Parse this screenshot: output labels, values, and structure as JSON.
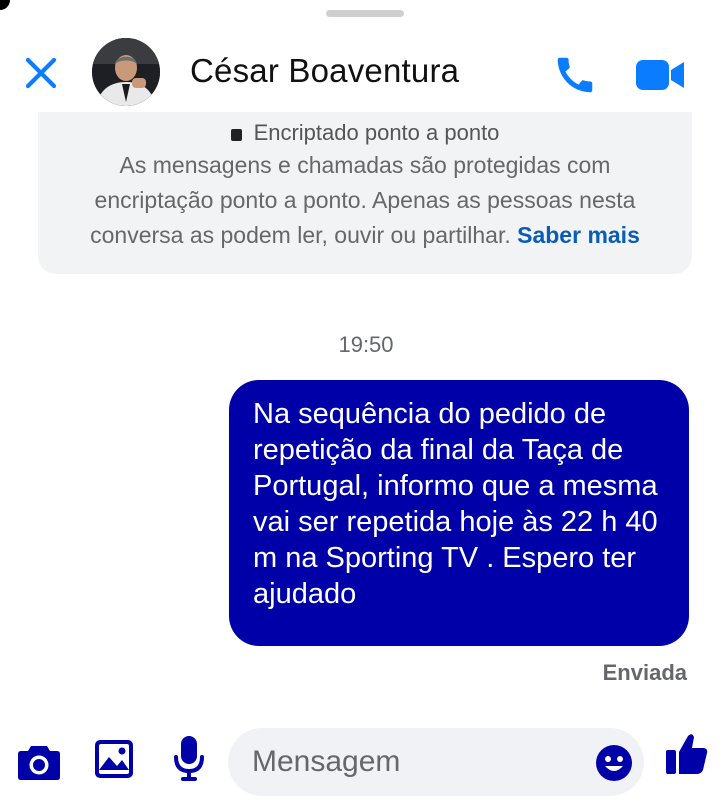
{
  "header": {
    "contact_name": "César Boaventura"
  },
  "encryption_notice": {
    "title": "Encriptado ponto a ponto",
    "body": "As mensagens e chamadas são protegidas com encriptação ponto a ponto. Apenas as pessoas nesta conversa as podem ler, ouvir ou partilhar.",
    "link": "Saber mais"
  },
  "conversation": {
    "timestamp": "19:50",
    "messages": [
      {
        "direction": "outgoing",
        "text": "Na sequência do pedido de repetição da final da Taça de Portugal, informo que a mesma vai ser repetida hoje às 22 h 40 m na Sporting TV . Espero ter ajudado",
        "status": "Enviada"
      }
    ]
  },
  "composer": {
    "placeholder": "Mensagem"
  },
  "icons": {
    "close": "close-icon",
    "call": "phone-icon",
    "video": "video-camera-icon",
    "camera": "camera-icon",
    "gallery": "image-icon",
    "mic": "microphone-icon",
    "emoji": "emoji-icon",
    "like": "thumbs-up-icon"
  },
  "colors": {
    "accent": "#0a7cff",
    "bubble": "#0000a8",
    "secondary_text": "#65676b"
  }
}
